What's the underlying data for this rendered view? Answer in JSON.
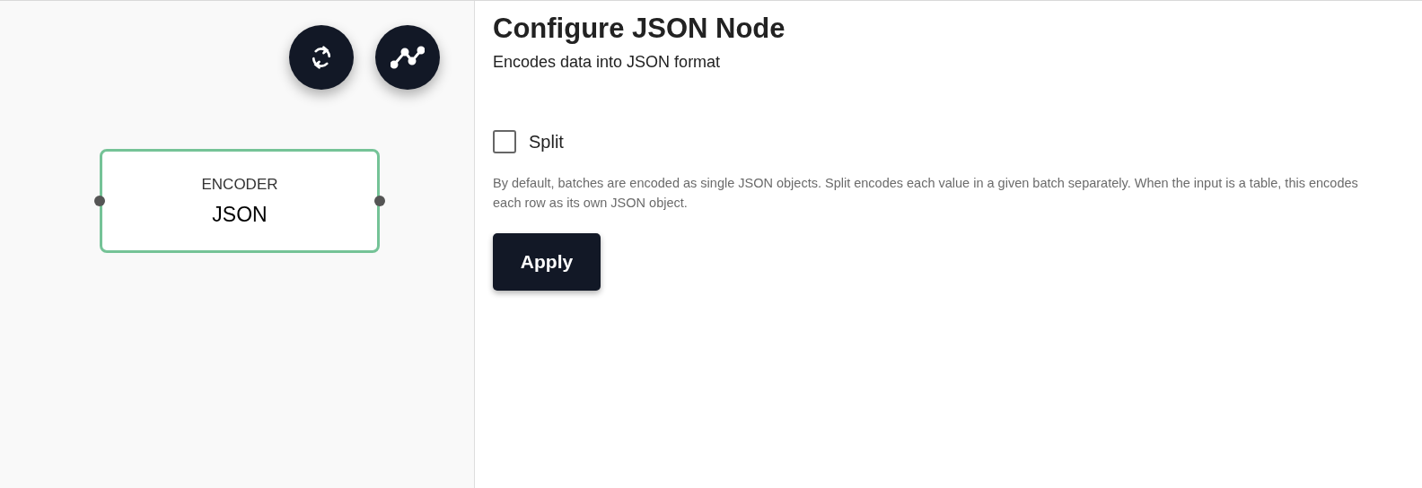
{
  "canvas": {
    "toolbar": [
      {
        "kind": "refresh"
      },
      {
        "kind": "chart"
      }
    ],
    "node": {
      "category": "ENCODER",
      "name": "JSON",
      "selected": true
    }
  },
  "panel": {
    "title": "Configure JSON Node",
    "subtitle": "Encodes data into JSON format",
    "option": {
      "label": "Split",
      "checked": false
    },
    "description": "By default, batches are encoded as single JSON objects. Split encodes each value in a given batch separately. When the input is a table, this encodes each row as its own JSON object.",
    "button": "Apply"
  }
}
